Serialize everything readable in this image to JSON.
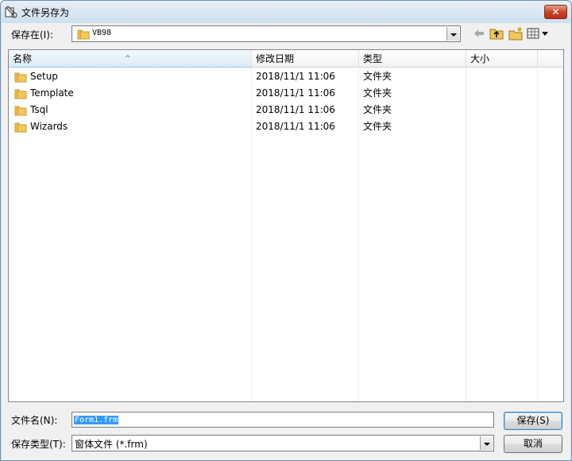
{
  "window": {
    "title": "文件另存为",
    "close_glyph": "✕"
  },
  "toolbar": {
    "save_in_label": "保存在(I):",
    "location": "VB98",
    "icons": [
      "back-arrow-icon",
      "up-folder-icon",
      "new-folder-icon",
      "view-menu-icon"
    ]
  },
  "file_list": {
    "columns": [
      "名称",
      "修改日期",
      "类型",
      "大小"
    ],
    "sorted_column": "名称",
    "rows": [
      {
        "name": "Setup",
        "modified": "2018/11/1 11:06",
        "type": "文件夹",
        "size": ""
      },
      {
        "name": "Template",
        "modified": "2018/11/1 11:06",
        "type": "文件夹",
        "size": ""
      },
      {
        "name": "Tsql",
        "modified": "2018/11/1 11:06",
        "type": "文件夹",
        "size": ""
      },
      {
        "name": "Wizards",
        "modified": "2018/11/1 11:06",
        "type": "文件夹",
        "size": ""
      }
    ]
  },
  "footer": {
    "filename_label": "文件名(N):",
    "filename_value": "Form1.frm",
    "filetype_label": "保存类型(T):",
    "filetype_value": "窗体文件 (*.frm)",
    "save_button": "保存(S)",
    "cancel_button": "取消"
  },
  "colors": {
    "selection": "#3399ff",
    "folder": "#f2c75c",
    "close_button": "#c8452a"
  }
}
